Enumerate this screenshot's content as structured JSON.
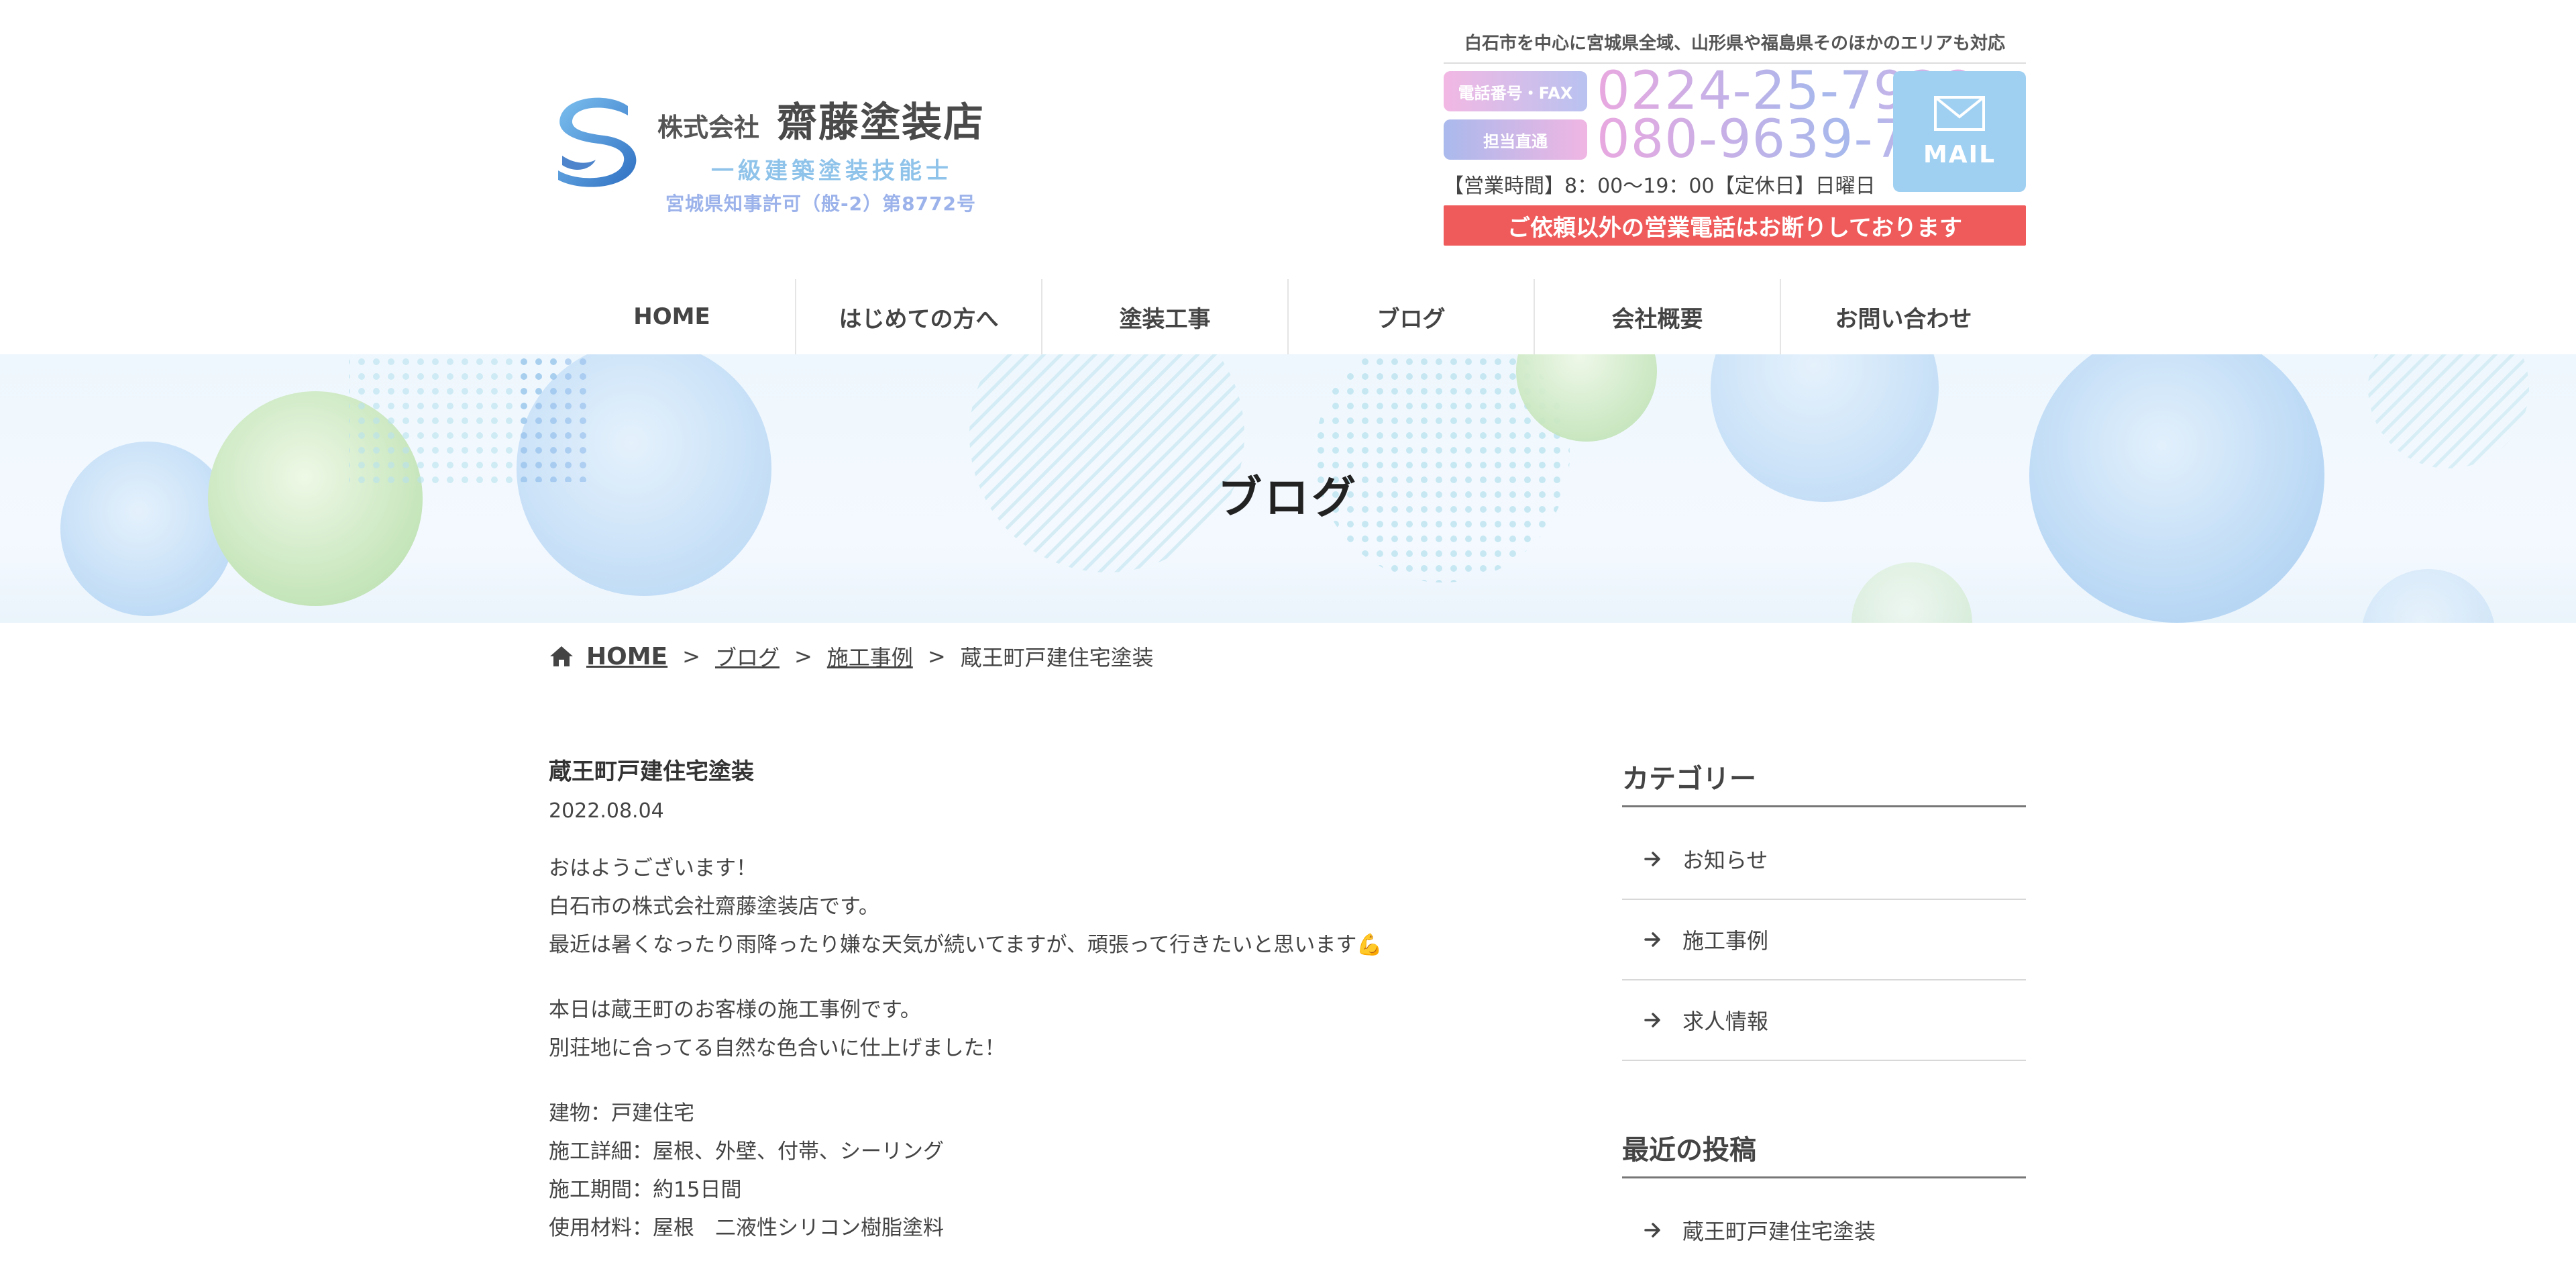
{
  "header": {
    "logo": {
      "kabushiki": "株式会社",
      "name": "齋藤塗装店",
      "sub1": "一級建築塗装技能士",
      "sub2": "宮城県知事許可（般-2）第8772号"
    },
    "contact": {
      "area": "白石市を中心に宮城県全域、山形県や福島県そのほかのエリアも対応",
      "tel_label": "電話番号・FAX",
      "tel": "0224-25-7928",
      "mobile_label": "担当直通",
      "mobile": "080-9639-7839",
      "mail_label": "MAIL",
      "hours": "【営業時間】8：00～19：00【定休日】日曜日",
      "notice": "ご依頼以外の営業電話はお断りしております"
    }
  },
  "nav": [
    {
      "label": "HOME"
    },
    {
      "label": "はじめての方へ"
    },
    {
      "label": "塗装工事"
    },
    {
      "label": "ブログ"
    },
    {
      "label": "会社概要"
    },
    {
      "label": "お問い合わせ"
    }
  ],
  "hero": {
    "title": "ブログ"
  },
  "breadcrumb": {
    "home": "HOME",
    "blog": "ブログ",
    "category": "施工事例",
    "current": "蔵王町戸建住宅塗装",
    "separator": ">"
  },
  "article": {
    "title": "蔵王町戸建住宅塗装",
    "date": "2022.08.04",
    "paragraphs": [
      [
        "おはようございます！",
        "白石市の株式会社齋藤塗装店です。",
        "最近は暑くなったり雨降ったり嫌な天気が続いてますが、頑張って行きたいと思います💪"
      ],
      [
        "本日は蔵王町のお客様の施工事例です。",
        "別荘地に合ってる自然な色合いに仕上げました！"
      ],
      [
        "建物：戸建住宅",
        "施工詳細：屋根、外壁、付帯、シーリング",
        "施工期間：約15日間",
        "使用材料：屋根　二液性シリコン樹脂塗料"
      ]
    ]
  },
  "sidebar": {
    "category_heading": "カテゴリー",
    "categories": [
      "お知らせ",
      "施工事例",
      "求人情報"
    ],
    "recent_heading": "最近の投稿",
    "recent": [
      "蔵王町戸建住宅塗装"
    ]
  },
  "colors": {
    "notice_bg": "#ef5b5b",
    "mail_bg": "#9fd0f2",
    "logo_blue": "#3d86d4"
  }
}
